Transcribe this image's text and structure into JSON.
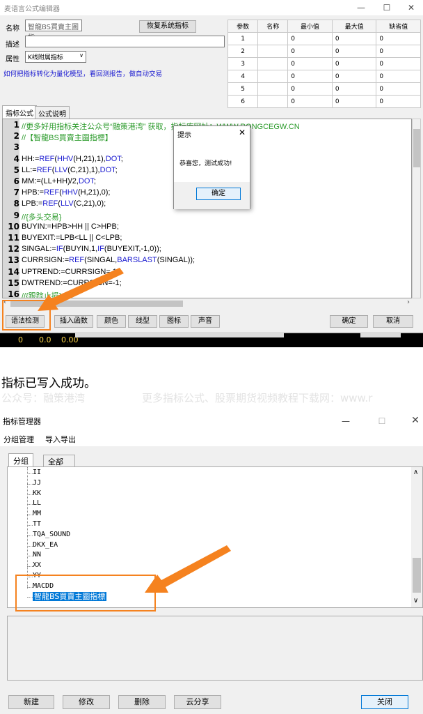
{
  "editor": {
    "title": "麦语言公式编辑器",
    "fields": {
      "name_label": "名称",
      "name_value": "智龍BS買賣主圖指",
      "desc_label": "描述",
      "attr_label": "属性",
      "attr_value": "K线附属指标",
      "restore_button": "恢复系统指标",
      "help_link": "如何把指标转化为量化模型，看回测报告，做自动交易"
    },
    "param_table": {
      "headers": [
        "参数",
        "名称",
        "最小值",
        "最大值",
        "缺省值"
      ],
      "rows": [
        [
          "1",
          "",
          "0",
          "0",
          "0"
        ],
        [
          "2",
          "",
          "0",
          "0",
          "0"
        ],
        [
          "3",
          "",
          "0",
          "0",
          "0"
        ],
        [
          "4",
          "",
          "0",
          "0",
          "0"
        ],
        [
          "5",
          "",
          "0",
          "0",
          "0"
        ],
        [
          "6",
          "",
          "0",
          "0",
          "0"
        ]
      ]
    },
    "tabs": [
      "指标公式",
      "公式说明"
    ],
    "code_lines": [
      {
        "n": "1",
        "t": "//更多好用指标关注公众号“融策港湾” 获取，指标库网址：WWW.RONGCEGW.CN"
      },
      {
        "n": "2",
        "t": "//【智龍BS買賣主圖指標】"
      },
      {
        "n": "3",
        "t": ""
      },
      {
        "n": "4",
        "t": "HH:=REF(HHV(H,21),1),DOT;"
      },
      {
        "n": "5",
        "t": "LL:=REF(LLV(C,21),1),DOT;"
      },
      {
        "n": "6",
        "t": "MM:=(LL+HH)/2,DOT;"
      },
      {
        "n": "7",
        "t": "HPB:=REF(HHV(H,21),0);"
      },
      {
        "n": "8",
        "t": "LPB:=REF(LLV(C,21),0);"
      },
      {
        "n": "9",
        "t": " //{多头交易}"
      },
      {
        "n": "10",
        "t": "BUYIN:=HPB>HH || C>HPB;"
      },
      {
        "n": "11",
        "t": "BUYEXIT:=LPB<LL || C<LPB;"
      },
      {
        "n": "12",
        "t": "SINGAL:=IF(BUYIN,1,IF(BUYEXIT,-1,0));"
      },
      {
        "n": "13",
        "t": "CURRSIGN:=REF(SINGAL,BARSLAST(SINGAL));"
      },
      {
        "n": "14",
        "t": " UPTREND:=CURRSIGN= 1;"
      },
      {
        "n": "15",
        "t": " DWTREND:=CURRSIGN=-1;"
      },
      {
        "n": "16",
        "t": " //{跟踪止损}"
      }
    ],
    "bottom_buttons": [
      "语法检测",
      "插入函数",
      "颜色",
      "线型",
      "图标",
      "声音"
    ],
    "ok_button": "确定",
    "cancel_button": "取消",
    "status_values": [
      "0",
      "0.0",
      "0.00"
    ]
  },
  "dialog": {
    "title": "提示",
    "message": "恭喜您，测试成功!",
    "ok": "确定"
  },
  "caption": "指标已写入成功。",
  "watermark": {
    "left": "公众号：融策港湾",
    "right": "更多指标公式、股票期货视频教程下载网：www.r"
  },
  "manager": {
    "title": "指标管理器",
    "menu": [
      "分组管理",
      "导入导出"
    ],
    "tabs": [
      "分组",
      "全部"
    ],
    "tree_items": [
      "II",
      "JJ",
      "KK",
      "LL",
      "MM",
      "TT",
      "TQA_SOUND",
      "DKX_EA",
      "NN",
      "XX",
      "YY",
      "MACDD"
    ],
    "selected_item": "智龍BS買賣主圖指標",
    "buttons": [
      "新建",
      "修改",
      "删除",
      "云分享"
    ],
    "close_button": "关闭"
  },
  "colors": {
    "highlight": "#f5821f",
    "selection": "#0078d7",
    "link": "#1a1ad0",
    "comment": "#2a9a2a"
  }
}
